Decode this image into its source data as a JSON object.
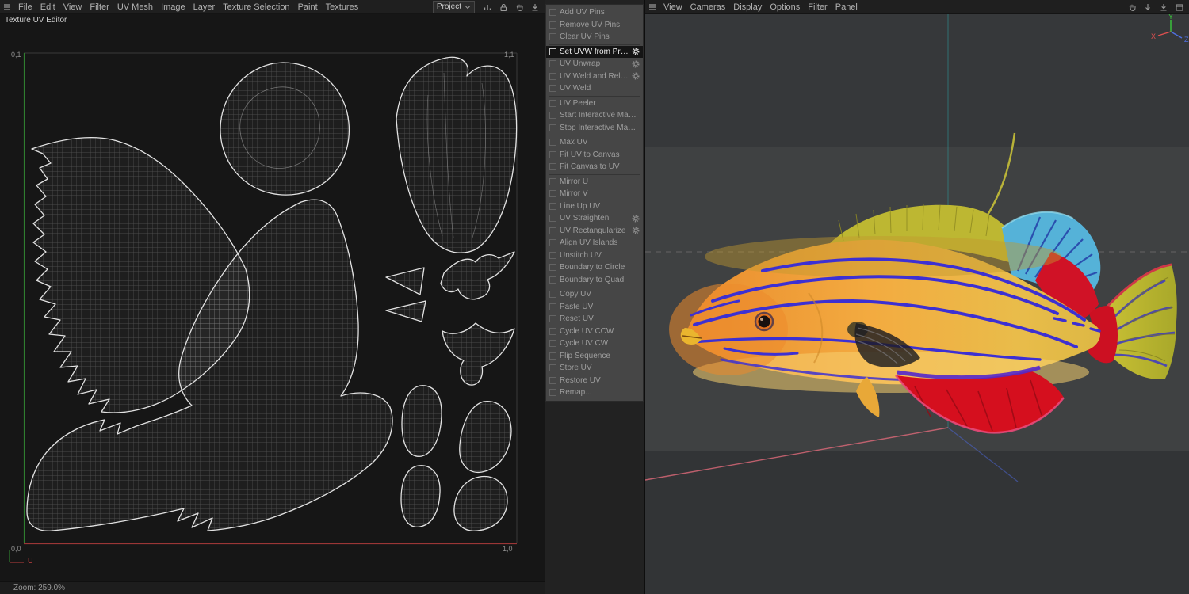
{
  "left_menubar": {
    "items": [
      "File",
      "Edit",
      "View",
      "Filter",
      "UV Mesh",
      "Image",
      "Layer",
      "Texture Selection",
      "Paint",
      "Textures"
    ]
  },
  "left_toolbar": {
    "project": "Project"
  },
  "left_panel": {
    "title": "Texture UV Editor",
    "status_zoom": "Zoom: 259.0%",
    "uv_corners": {
      "tl": "0,1",
      "tr": "1,1",
      "bl": "0,0",
      "br": "1,0"
    },
    "axis_u": "U"
  },
  "tool_panel": {
    "items": [
      {
        "label": "Add UV Pins"
      },
      {
        "label": "Remove UV Pins"
      },
      {
        "label": "Clear UV Pins"
      },
      {
        "label": "Set UVW from Projection",
        "selected": true,
        "gear": true
      },
      {
        "label": "UV Unwrap",
        "gear": true
      },
      {
        "label": "UV Weld and Relax",
        "gear": true
      },
      {
        "label": "UV Weld"
      },
      {
        "label": "UV Peeler"
      },
      {
        "label": "Start Interactive Mapping"
      },
      {
        "label": "Stop Interactive Mapping"
      },
      {
        "label": "Max UV"
      },
      {
        "label": "Fit UV to Canvas"
      },
      {
        "label": "Fit Canvas to UV"
      },
      {
        "label": "Mirror U"
      },
      {
        "label": "Mirror V"
      },
      {
        "label": "Line Up UV"
      },
      {
        "label": "UV Straighten",
        "gear": true
      },
      {
        "label": "UV Rectangularize",
        "gear": true
      },
      {
        "label": "Align UV Islands"
      },
      {
        "label": "Unstitch UV"
      },
      {
        "label": "Boundary to Circle"
      },
      {
        "label": "Boundary to Quad"
      },
      {
        "label": "Copy UV"
      },
      {
        "label": "Paste UV"
      },
      {
        "label": "Reset UV"
      },
      {
        "label": "Cycle UV CCW"
      },
      {
        "label": "Cycle UV CW"
      },
      {
        "label": "Flip Sequence"
      },
      {
        "label": "Store UV"
      },
      {
        "label": "Restore UV"
      },
      {
        "label": "Remap..."
      }
    ]
  },
  "right_menubar": {
    "items": [
      "View",
      "Cameras",
      "Display",
      "Options",
      "Filter",
      "Panel"
    ]
  },
  "viewport_gizmo": {
    "x": "X",
    "y": "Y",
    "z": "Z"
  },
  "colors": {
    "accent_selected_row": "#151515",
    "uv_axis_u": "#9b3636",
    "uv_axis_v": "#2f7d2f",
    "fish_body": "#f3ab40",
    "fish_stripe": "#3d30d2",
    "fish_anal_fin": "#d50f1e",
    "fish_soft_dorsal": "#55b2d8"
  }
}
